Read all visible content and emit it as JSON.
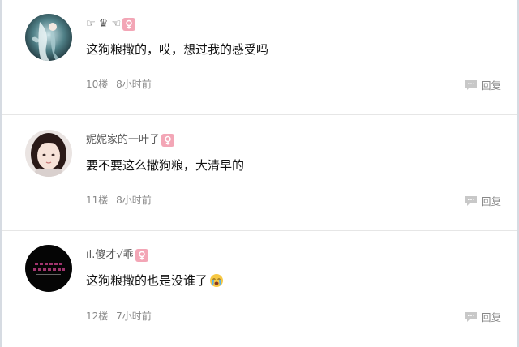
{
  "comments": [
    {
      "username": "☞ ♛ ☜",
      "badge_icon": "female-icon",
      "text": "这狗粮撒的，哎，想过我的感受吗",
      "floor": "10楼",
      "time": "8小时前",
      "reply_label": "回复"
    },
    {
      "username": "妮妮家的一叶子",
      "badge_icon": "female-icon",
      "text": "要不要这么撒狗粮，大清早的",
      "floor": "11楼",
      "time": "8小时前",
      "reply_label": "回复"
    },
    {
      "username": "ıl.傻才√乖",
      "badge_icon": "female-icon",
      "text": "这狗粮撒的也是没谁了",
      "emoji_icon": "crying-face-icon",
      "floor": "12楼",
      "time": "7小时前",
      "reply_label": "回复"
    }
  ],
  "colors": {
    "badge": "#f3a6b6",
    "meta_text": "#888888",
    "divider": "#e6e6e6",
    "border": "#d6dbe2"
  }
}
